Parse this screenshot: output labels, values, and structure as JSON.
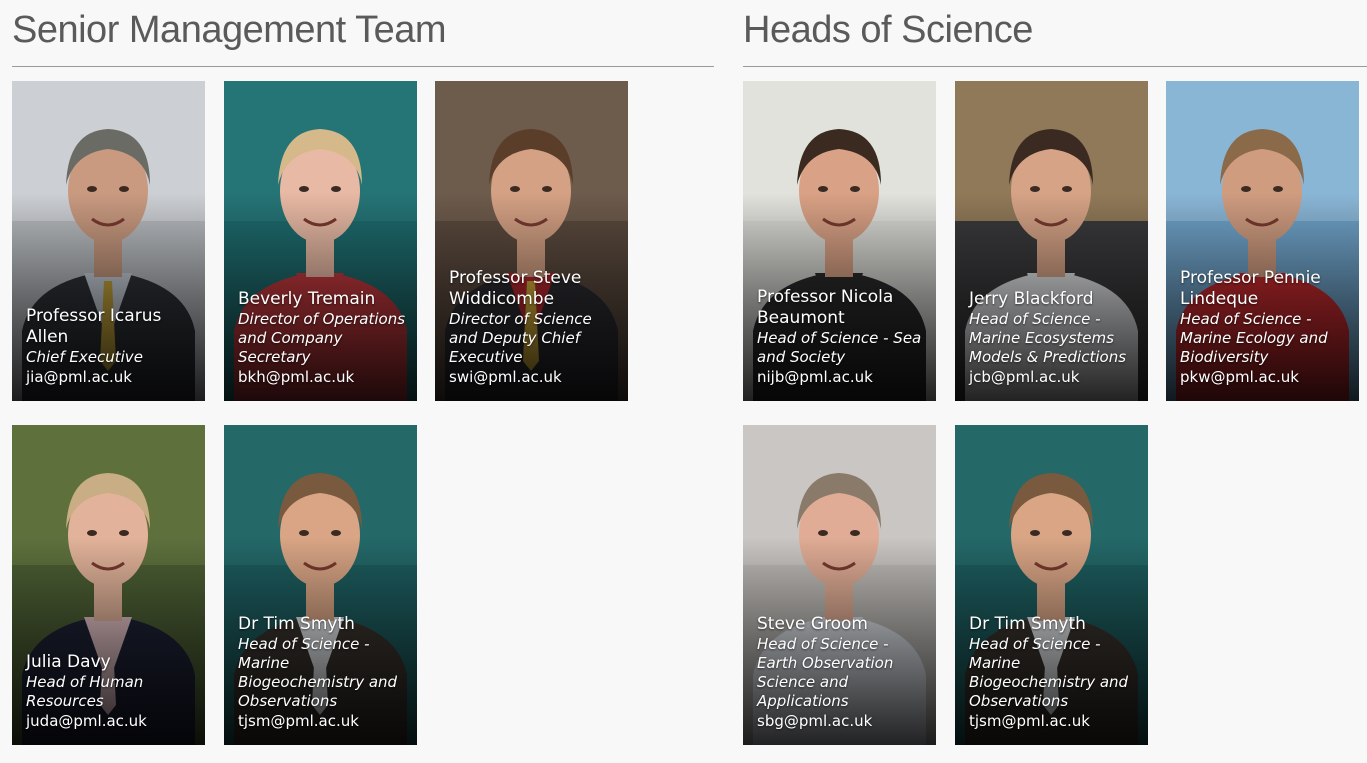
{
  "senior": {
    "title": "Senior Management Team",
    "members": [
      {
        "name": "Professor Icarus Allen",
        "role": "Chief Executive",
        "email": "jia@pml.ac.uk",
        "bg": "#b8bcc0",
        "sky": "#d8dcdf",
        "skin": "#c99a80",
        "hair": "#6b6b66",
        "suit": "#2f3237",
        "shirt": "#c9d2dc",
        "tie": "#c9a83c"
      },
      {
        "name": "Beverly Tremain",
        "role": "Director of Operations and Company Secretary",
        "email": "bkh@pml.ac.uk",
        "bg": "#1e6b6e",
        "sky": "#2a7a7c",
        "skin": "#e8b9a4",
        "hair": "#d6b98a",
        "suit": "#c73a3f",
        "shirt": "#c73a3f",
        "tie": "#c73a3f"
      },
      {
        "name": "Professor Steve Widdicombe",
        "role": "Director of Science and Deputy Chief Executive",
        "email": "swi@pml.ac.uk",
        "bg": "#5b4a3e",
        "sky": "#7a6757",
        "skin": "#d4a184",
        "hair": "#5a3e2a",
        "suit": "#2d2d33",
        "shirt": "#b92a2f",
        "tie": "#d9b13a"
      },
      {
        "name": "Julia Davy",
        "role": "Head of Human Resources",
        "email": "juda@pml.ac.uk",
        "bg": "#4c5f34",
        "sky": "#6b7d45",
        "skin": "#e2b39a",
        "hair": "#c9ad85",
        "suit": "#1e2236",
        "shirt": "#e6c3c8",
        "tie": "#e6c3c8"
      },
      {
        "name": "Dr Tim Smyth",
        "role": "Head of Science - Marine Biogeochemistry and Observations",
        "email": "tjsm@pml.ac.uk",
        "bg": "#1d5c5e",
        "sky": "#2a6f70",
        "skin": "#d9a585",
        "hair": "#7a5a3e",
        "suit": "#3a342e",
        "shirt": "#e8ecef",
        "tie": "#e8ecef"
      }
    ]
  },
  "heads": {
    "title": "Heads of Science",
    "members": [
      {
        "name": "Professor Nicola Beaumont",
        "role": "Head of Science - Sea and Society",
        "email": "nijb@pml.ac.uk",
        "bg": "#d9d9d5",
        "sky": "#e7e7e3",
        "skin": "#d9a185",
        "hair": "#3a2a20",
        "suit": "#2b2b2b",
        "shirt": "#2b2b2b",
        "tie": "#2b2b2b"
      },
      {
        "name": "Jerry Blackford",
        "role": "Head of Science - Marine Ecosystems Models & Predictions",
        "email": "jcb@pml.ac.uk",
        "bg": "#3a3a3c",
        "sky": "#c9a36a",
        "skin": "#d6a386",
        "hair": "#3a2a22",
        "suit": "#e4e6e8",
        "shirt": "#e4e6e8",
        "tie": "#e4e6e8"
      },
      {
        "name": "Professor Pennie Lindeque",
        "role": "Head of Science - Marine Ecology and Biodiversity",
        "email": "pkw@pml.ac.uk",
        "bg": "#6fa3c9",
        "sky": "#9cc3e0",
        "skin": "#cf9c80",
        "hair": "#8b6a4a",
        "suit": "#c92b2f",
        "shirt": "#c92b2f",
        "tie": "#c92b2f"
      },
      {
        "name": "Steve Groom",
        "role": "Head of Science - Earth Observation Science and Applications",
        "email": "sbg@pml.ac.uk",
        "bg": "#bdbab6",
        "sky": "#d2cfcb",
        "skin": "#e0ac95",
        "hair": "#8a7a6a",
        "suit": "#dfe4ea",
        "shirt": "#dfe4ea",
        "tie": "#dfe4ea"
      },
      {
        "name": "Dr Tim Smyth",
        "role": "Head of Science - Marine Biogeochemistry and Observations",
        "email": "tjsm@pml.ac.uk",
        "bg": "#1d5c5e",
        "sky": "#2a6f70",
        "skin": "#d9a585",
        "hair": "#7a5a3e",
        "suit": "#3a342e",
        "shirt": "#e8ecef",
        "tie": "#e8ecef"
      }
    ]
  }
}
